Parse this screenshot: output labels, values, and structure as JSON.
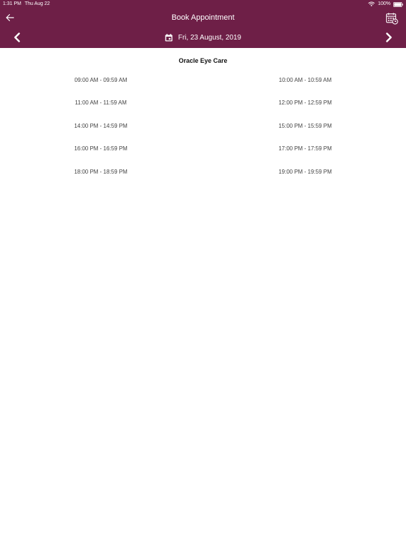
{
  "status_bar": {
    "time": "1:31 PM",
    "date": "Thu Aug 22",
    "battery": "100%"
  },
  "header": {
    "title": "Book Appointment",
    "selected_date": "Fri, 23 August, 2019",
    "background_color": "#6e1f47",
    "icons": {
      "back": "arrow-left-icon",
      "calendar": "calendar-clock-icon",
      "prev": "chevron-left-icon",
      "next": "chevron-right-icon",
      "date": "calendar-icon"
    }
  },
  "clinic": {
    "name": "Oracle Eye Care"
  },
  "slots": [
    "09:00 AM - 09:59 AM",
    "10:00 AM - 10:59 AM",
    "11:00 AM - 11:59 AM",
    "12:00 PM - 12:59 PM",
    "14:00 PM - 14:59 PM",
    "15:00 PM - 15:59 PM",
    "16:00 PM - 16:59 PM",
    "17:00 PM - 17:59 PM",
    "18:00 PM - 18:59 PM",
    "19:00 PM - 19:59 PM"
  ]
}
